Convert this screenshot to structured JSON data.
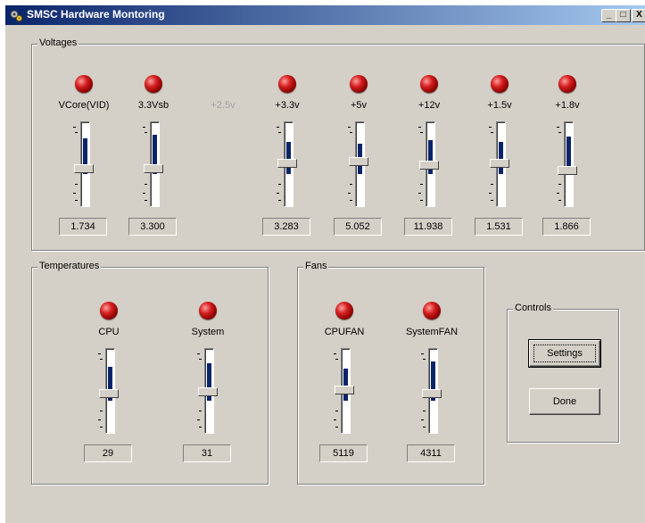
{
  "window": {
    "title": "SMSC Hardware Montoring",
    "min_label": "_",
    "max_label": "□",
    "close_label": "X"
  },
  "voltages": {
    "label": "Voltages",
    "sensors": [
      {
        "name": "VCore(VID)",
        "value": "1.734",
        "enabled": true
      },
      {
        "name": "3.3Vsb",
        "value": "3.300",
        "enabled": true
      },
      {
        "name": "+2.5v",
        "value": "",
        "enabled": false
      },
      {
        "name": "+3.3v",
        "value": "3.283",
        "enabled": true
      },
      {
        "name": "+5v",
        "value": "5.052",
        "enabled": true
      },
      {
        "name": "+12v",
        "value": "11.938",
        "enabled": true
      },
      {
        "name": "+1.5v",
        "value": "1.531",
        "enabled": true
      },
      {
        "name": "+1.8v",
        "value": "1.866",
        "enabled": true
      }
    ]
  },
  "temperatures": {
    "label": "Temperatures",
    "sensors": [
      {
        "name": "CPU",
        "value": "29",
        "enabled": true
      },
      {
        "name": "System",
        "value": "31",
        "enabled": true
      }
    ]
  },
  "fans": {
    "label": "Fans",
    "sensors": [
      {
        "name": "CPUFAN",
        "value": "5119",
        "enabled": true
      },
      {
        "name": "SystemFAN",
        "value": "4311",
        "enabled": true
      }
    ]
  },
  "controls": {
    "label": "Controls",
    "settings_label": "Settings",
    "done_label": "Done"
  },
  "colors": {
    "led": "#c41010",
    "bar": "#0a246a",
    "face": "#d4d0c8",
    "title_start": "#0a246a",
    "title_end": "#a6caf0"
  }
}
